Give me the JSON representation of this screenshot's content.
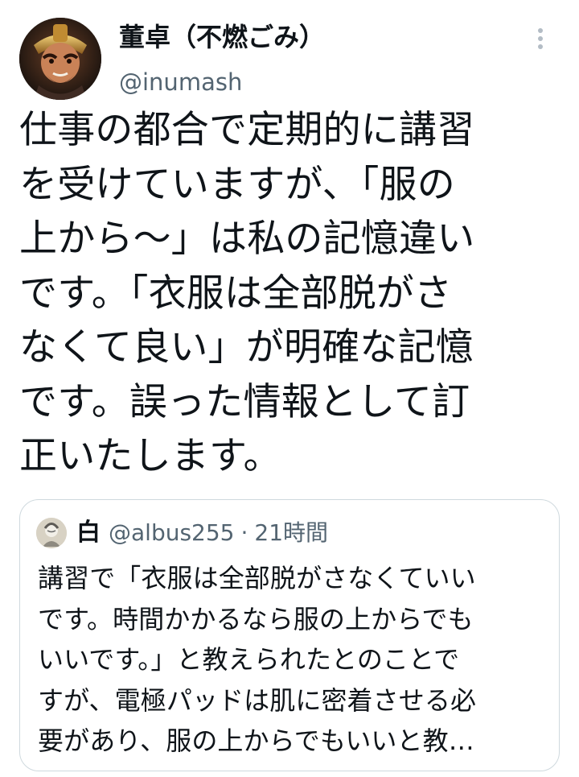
{
  "tweet": {
    "author": {
      "display_name": "董卓（不燃ごみ）",
      "handle": "@inumash"
    },
    "more_icon": "more-vertical-icon",
    "text": "仕事の都合で定期的に講習\nを受けていますが、「服の\n上から〜」は私の記憶違い\nです。「衣服は全部脱がさ\nなくて良い」が明確な記憶\nです。誤った情報として訂\n正いたします。"
  },
  "quote": {
    "author": {
      "display_name": "白",
      "handle": "@albus255",
      "separator": "·",
      "time": "21時間"
    },
    "text": "講習で「衣服は全部脱がさなくていい\nです。時間かかるなら服の上からでも\nいいです。」と教えられたとのことで\nすが、電極パッドは肌に密着させる必\n要があり、服の上からでもいいと教…"
  }
}
